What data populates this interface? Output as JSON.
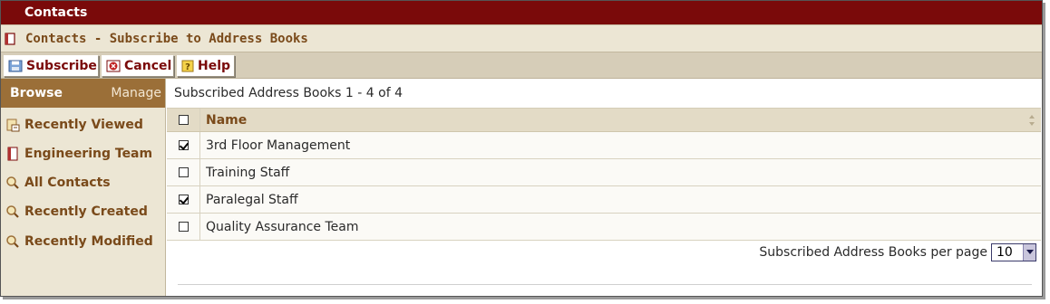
{
  "window": {
    "title": "Contacts"
  },
  "header": {
    "subtitle": "Contacts - Subscribe to Address Books"
  },
  "toolbar": {
    "subscribe_label": "Subscribe",
    "cancel_label": "Cancel",
    "help_label": "Help"
  },
  "sidebar": {
    "browse_label": "Browse",
    "manage_label": "Manage",
    "items": [
      {
        "label": "Recently Viewed",
        "icon": "recent-book-icon"
      },
      {
        "label": "Engineering Team",
        "icon": "address-book-icon"
      },
      {
        "label": "All Contacts",
        "icon": "search-icon"
      },
      {
        "label": "Recently Created",
        "icon": "search-icon"
      },
      {
        "label": "Recently Modified",
        "icon": "search-icon"
      }
    ]
  },
  "main": {
    "count_text": "Subscribed Address Books 1 - 4 of 4",
    "column_name": "Name",
    "rows": [
      {
        "name": "3rd Floor Management",
        "checked": true
      },
      {
        "name": "Training Staff",
        "checked": false
      },
      {
        "name": "Paralegal Staff",
        "checked": true
      },
      {
        "name": "Quality Assurance Team",
        "checked": false
      }
    ],
    "per_page_label": "Subscribed Address Books per page",
    "per_page_value": "10"
  },
  "colors": {
    "titlebar": "#7a0a0a",
    "accent_text": "#7a4a1a",
    "browse_bar": "#9b6f38",
    "panel_bg": "#ece6d4",
    "toolbar_bg": "#d6cdb8"
  }
}
